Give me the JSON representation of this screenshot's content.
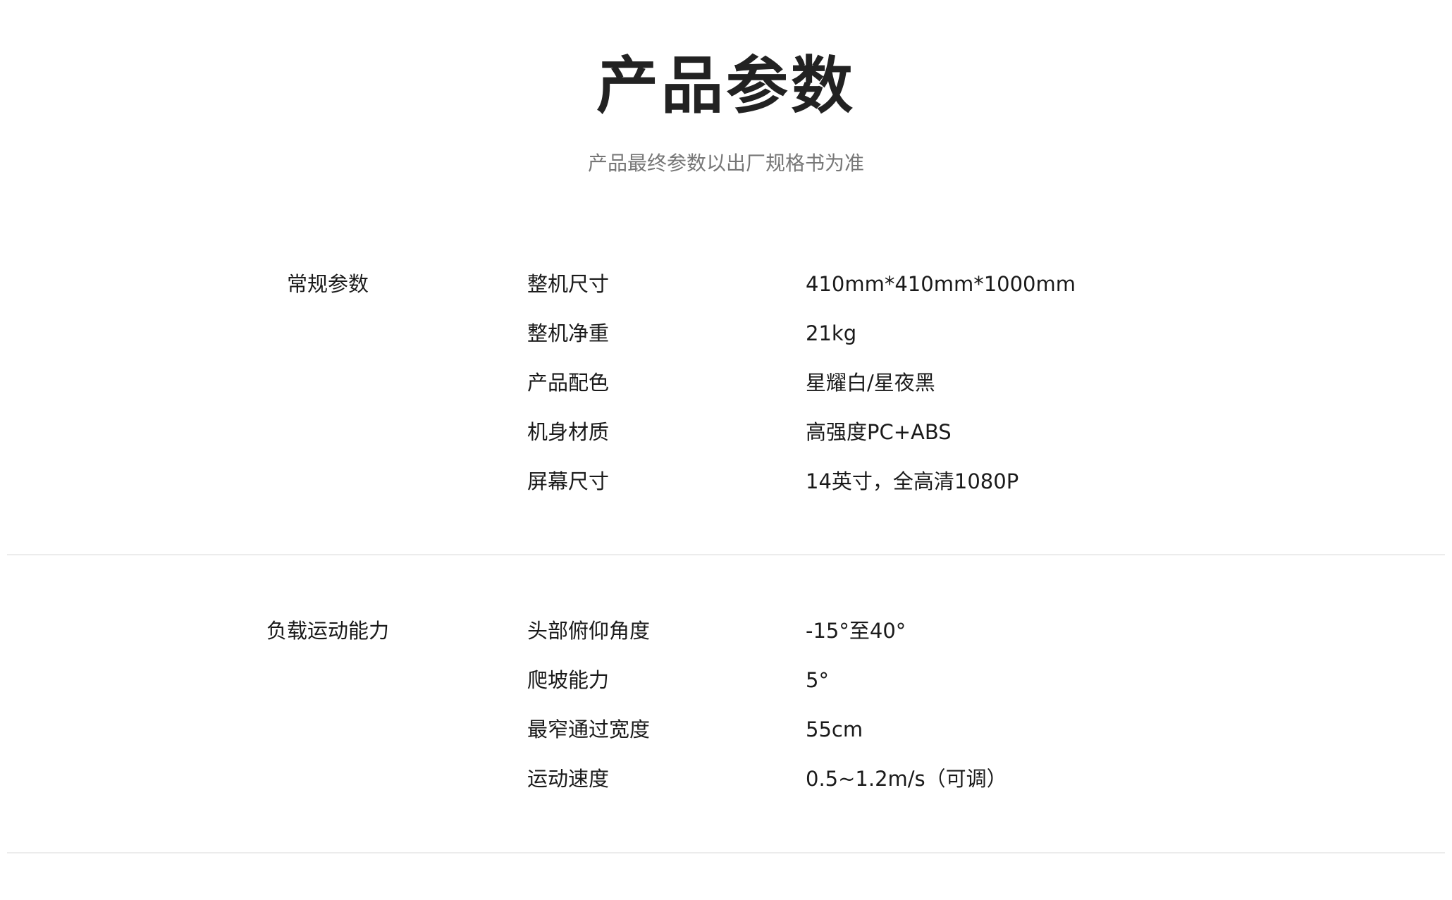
{
  "header": {
    "title": "产品参数",
    "subtitle": "产品最终参数以出厂规格书为准"
  },
  "sections": [
    {
      "category": "常规参数",
      "rows": [
        {
          "label": "整机尺寸",
          "value": "410mm*410mm*1000mm"
        },
        {
          "label": "整机净重",
          "value": "21kg"
        },
        {
          "label": "产品配色",
          "value": "星耀白/星夜黑"
        },
        {
          "label": "机身材质",
          "value": "高强度PC+ABS"
        },
        {
          "label": "屏幕尺寸",
          "value": "14英寸，全高清1080P"
        }
      ]
    },
    {
      "category": "负载运动能力",
      "rows": [
        {
          "label": "头部俯仰角度",
          "value": "-15°至40°"
        },
        {
          "label": "爬坡能力",
          "value": "5°"
        },
        {
          "label": "最窄通过宽度",
          "value": "55cm"
        },
        {
          "label": "运动速度",
          "value": "0.5~1.2m/s（可调）"
        }
      ]
    }
  ]
}
